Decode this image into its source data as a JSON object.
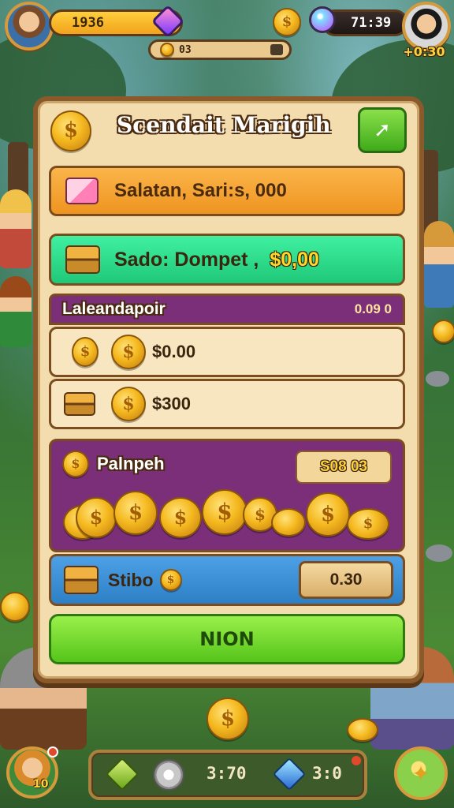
{
  "hud": {
    "left_value": "1936",
    "sub_value": "03",
    "right_value": "71:39",
    "right_bonus": "+0:30"
  },
  "panel": {
    "title": "Scendait Marigih",
    "balance_label": "Salatan, Sari:s, 000",
    "deposit_label": "Sado: Dompet ,",
    "deposit_amount": "$0,00",
    "section_title": "Laleandapoir",
    "section_value": "0.09 0",
    "items": [
      {
        "value": "$0.00"
      },
      {
        "value": "$300"
      }
    ],
    "purple_label": "Palnpeh",
    "purple_value": "S08 03",
    "blue_label": "Stibo",
    "blue_value": "0.30",
    "confirm_label": "NION"
  },
  "bottom": {
    "left_level": "10",
    "left_value": "3:70",
    "right_value": "3:0"
  },
  "colors": {
    "accent_green": "#5fd02a",
    "orange_row": "#f4a33a",
    "teal_row": "#2fd88a",
    "purple": "#7a2f78",
    "blue_row": "#3f8fd6"
  }
}
